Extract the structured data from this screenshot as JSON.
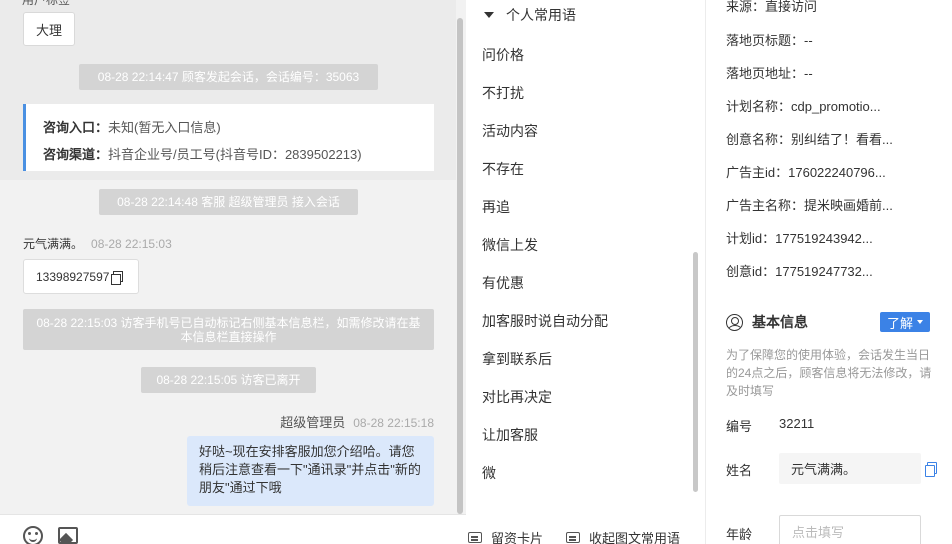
{
  "chat": {
    "top_cut_text": "用户标签",
    "tag": "大理",
    "sys_session_start": "08-28 22:14:47 顾客发起会话，会话编号：35063",
    "consult": {
      "entry_label": "咨询入口：",
      "entry_value": "未知(暂无入口信息)",
      "channel_label": "咨询渠道：",
      "channel_value": "抖音企业号/员工号(抖音号ID：2839502213)"
    },
    "sys_agent_join": "08-28 22:14:48 客服 超级管理员 接入会话",
    "visitor_name": "元气满满。",
    "visitor_time": "08-28 22:15:03",
    "visitor_phone": "13398927597",
    "sys_phone_marked": "08-28 22:15:03 访客手机号已自动标记右侧基本信息栏，如需修改请在基本信息栏直接操作",
    "sys_visitor_left": "08-28 22:15:05 访客已离开",
    "agent_name": "超级管理员",
    "agent_time": "08-28 22:15:18",
    "agent_message": "好哒~现在安排客服加您介绍哈。请您稍后注意查看一下\"通讯录\"并点击\"新的朋友\"通过下哦"
  },
  "phrases": {
    "header": "个人常用语",
    "items": [
      "问价格",
      "不打扰",
      "活动内容",
      "不存在",
      "再追",
      "微信上发",
      "有优惠",
      "加客服时说自动分配",
      "拿到联系后",
      "对比再决定",
      "让加客服",
      "微"
    ],
    "footer_card": "留资卡片",
    "footer_collect": "收起图文常用语"
  },
  "info": {
    "source": {
      "label": "来源：",
      "value": "直接访问"
    },
    "landing_title": {
      "label": "落地页标题：",
      "value": "--"
    },
    "landing_url": {
      "label": "落地页地址：",
      "value": "--"
    },
    "plan_name": {
      "label": "计划名称：",
      "value": "cdp_promotio..."
    },
    "creative_name": {
      "label": "创意名称：",
      "value": "别纠结了！看看..."
    },
    "advertiser_id": {
      "label": "广告主id：",
      "value": "176022240796..."
    },
    "advertiser_name": {
      "label": "广告主名称：",
      "value": "提米映画婚前..."
    },
    "plan_id": {
      "label": "计划id：",
      "value": "177519243942..."
    },
    "creative_id": {
      "label": "创意id：",
      "value": "177519247732..."
    },
    "basic_title": "基本信息",
    "learn_more": "了解",
    "notice": "为了保障您的使用体验，会话发生当日的24点之后，顾客信息将无法修改，请及时填写",
    "id_label": "编号",
    "id_value": "32211",
    "name_label": "姓名",
    "name_value": "元气满满。",
    "age_label": "年龄",
    "age_placeholder": "点击填写"
  }
}
